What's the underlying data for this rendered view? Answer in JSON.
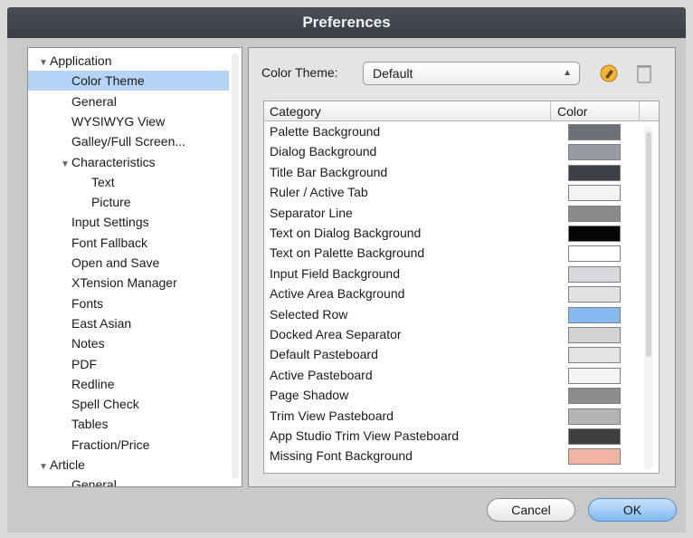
{
  "window": {
    "title": "Preferences"
  },
  "tree": {
    "items": [
      {
        "label": "Application",
        "indent": 0,
        "expanded": true
      },
      {
        "label": "Color Theme",
        "indent": 1,
        "selected": true
      },
      {
        "label": "General",
        "indent": 1
      },
      {
        "label": "WYSIWYG View",
        "indent": 1
      },
      {
        "label": "Galley/Full Screen...",
        "indent": 1
      },
      {
        "label": "Characteristics",
        "indent": 1,
        "expanded": true
      },
      {
        "label": "Text",
        "indent": 2
      },
      {
        "label": "Picture",
        "indent": 2
      },
      {
        "label": "Input Settings",
        "indent": 1
      },
      {
        "label": "Font Fallback",
        "indent": 1
      },
      {
        "label": "Open and Save",
        "indent": 1
      },
      {
        "label": "XTension Manager",
        "indent": 1
      },
      {
        "label": "Fonts",
        "indent": 1
      },
      {
        "label": "East Asian",
        "indent": 1
      },
      {
        "label": "Notes",
        "indent": 1
      },
      {
        "label": "PDF",
        "indent": 1
      },
      {
        "label": "Redline",
        "indent": 1
      },
      {
        "label": "Spell Check",
        "indent": 1
      },
      {
        "label": "Tables",
        "indent": 1
      },
      {
        "label": "Fraction/Price",
        "indent": 1
      },
      {
        "label": "Article",
        "indent": 0,
        "expanded": true
      },
      {
        "label": "General",
        "indent": 1
      }
    ]
  },
  "theme": {
    "label": "Color Theme:",
    "value": "Default"
  },
  "table": {
    "headers": {
      "category": "Category",
      "color": "Color"
    },
    "rows": [
      {
        "category": "Palette Background",
        "color": "#6b7079"
      },
      {
        "category": "Dialog Background",
        "color": "#979ba2"
      },
      {
        "category": "Title Bar Background",
        "color": "#3c3f45"
      },
      {
        "category": "Ruler / Active Tab",
        "color": "#f3f3f3"
      },
      {
        "category": "Separator Line",
        "color": "#8a8a8a"
      },
      {
        "category": "Text on Dialog Background",
        "color": "#050505"
      },
      {
        "category": "Text on Palette Background",
        "color": "#ffffff"
      },
      {
        "category": "Input Field Background",
        "color": "#d6d8db"
      },
      {
        "category": "Active Area Background",
        "color": "#e2e2e2"
      },
      {
        "category": "Selected Row",
        "color": "#86b9f0"
      },
      {
        "category": "Docked Area Separator",
        "color": "#d3d3d3"
      },
      {
        "category": "Default Pasteboard",
        "color": "#e3e3e3"
      },
      {
        "category": "Active Pasteboard",
        "color": "#f4f4f4"
      },
      {
        "category": "Page Shadow",
        "color": "#8c8c8c"
      },
      {
        "category": "Trim View Pasteboard",
        "color": "#b3b3b3"
      },
      {
        "category": "App Studio Trim View Pasteboard",
        "color": "#3e3e3e"
      },
      {
        "category": "Missing Font Background",
        "color": "#f2b4a2"
      }
    ]
  },
  "buttons": {
    "cancel": "Cancel",
    "ok": "OK"
  }
}
